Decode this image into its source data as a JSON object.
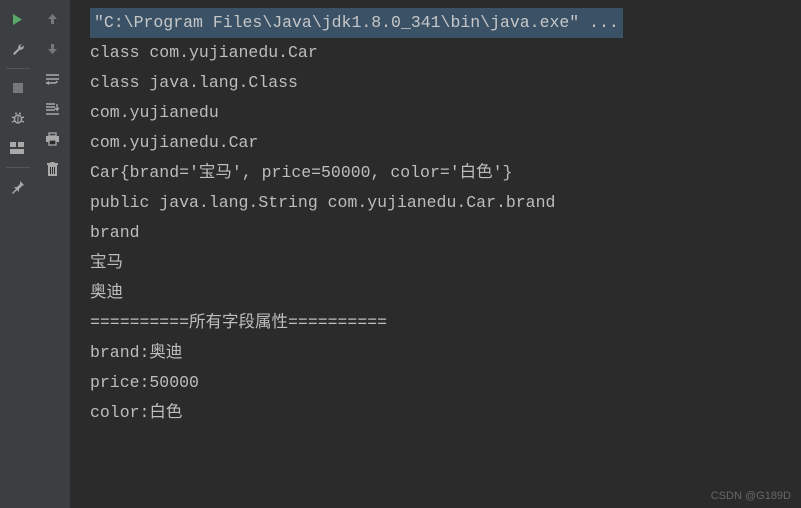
{
  "toolbar_primary": {
    "run": "run-icon",
    "wrench": "wrench-icon",
    "stop": "stop-icon",
    "bug": "bug-icon",
    "layout": "layout-icon",
    "pin": "pin-icon"
  },
  "toolbar_secondary": {
    "up": "arrow-up-icon",
    "down": "arrow-down-icon",
    "wrap": "wrap-icon",
    "scroll": "scroll-icon",
    "print": "print-icon",
    "trash": "trash-icon"
  },
  "console": {
    "lines": [
      "\"C:\\Program Files\\Java\\jdk1.8.0_341\\bin\\java.exe\" ...",
      "class com.yujianedu.Car",
      "class java.lang.Class",
      "com.yujianedu",
      "com.yujianedu.Car",
      "Car{brand='宝马', price=50000, color='白色'}",
      "public java.lang.String com.yujianedu.Car.brand",
      "brand",
      "宝马",
      "奥迪",
      "==========所有字段属性==========",
      "brand:奥迪",
      "price:50000",
      "color:白色"
    ]
  },
  "watermark": "CSDN @G189D"
}
